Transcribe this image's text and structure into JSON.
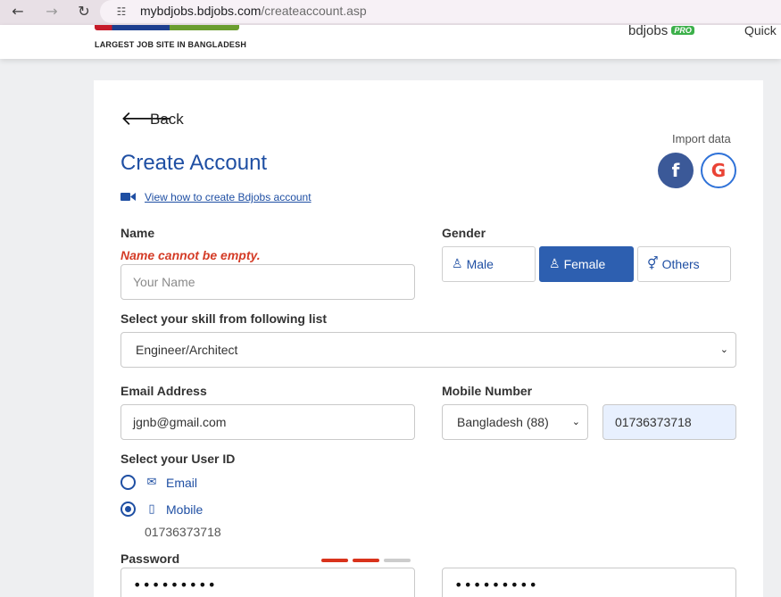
{
  "browser": {
    "back_icon": "arrow-left-icon",
    "forward_icon": "arrow-right-icon",
    "reload_icon": "reload-icon",
    "url_host": "mybdjobs.bdjobs.com",
    "url_path": "/createaccount.asp"
  },
  "site_header": {
    "tagline": "LARGEST JOB SITE IN BANGLADESH",
    "pro_brand": "bdjobs",
    "pro_badge": "PRO",
    "quick_link": "Quick"
  },
  "form": {
    "back_label": "Back",
    "import_label": "Import data",
    "facebook_glyph": "f",
    "google_glyph": "G",
    "title": "Create Account",
    "video_link": "View how to create Bdjobs account",
    "name": {
      "label": "Name",
      "error": "Name cannot be empty.",
      "placeholder": "Your Name",
      "value": ""
    },
    "gender": {
      "label": "Gender",
      "options": [
        "Male",
        "Female",
        "Others"
      ],
      "selected": "Female"
    },
    "skill": {
      "label": "Select your skill from following list",
      "value": "Engineer/Architect"
    },
    "email": {
      "label": "Email Address",
      "value": "jgnb@gmail.com"
    },
    "mobile": {
      "label": "Mobile Number",
      "country": "Bangladesh (88)",
      "number": "01736373718"
    },
    "user_id": {
      "label": "Select your User ID",
      "options": [
        "Email",
        "Mobile"
      ],
      "selected": "Mobile",
      "mobile_display": "01736373718"
    },
    "password": {
      "label": "Password",
      "masked": "•••••••••",
      "confirm_masked": "•••••••••",
      "strength_segments_filled": 2,
      "strength_segments_total": 3
    }
  },
  "colors": {
    "brand_blue": "#1f4fa3",
    "error_red": "#d43b26",
    "strength_red": "#d9331c",
    "facebook": "#3b5998"
  }
}
